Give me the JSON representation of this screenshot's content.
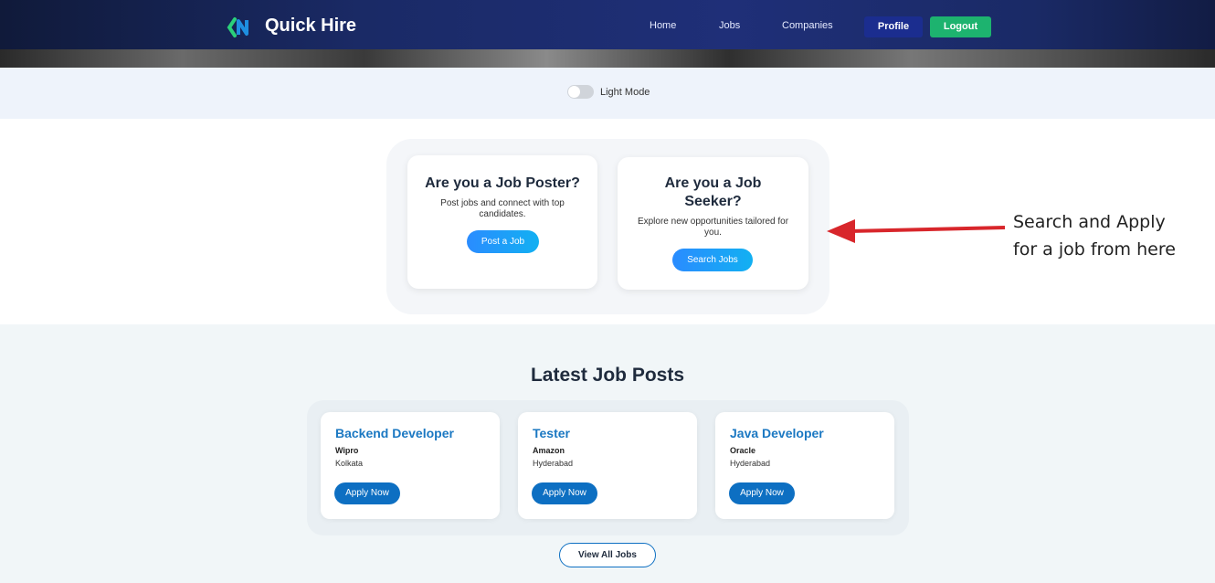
{
  "header": {
    "brand": "Quick Hire",
    "logo_icon": "quick-hire-logo",
    "nav": [
      {
        "label": "Home"
      },
      {
        "label": "Jobs"
      },
      {
        "label": "Companies"
      }
    ],
    "profile_label": "Profile",
    "logout_label": "Logout"
  },
  "theme_toggle": {
    "label": "Light Mode",
    "state": "off"
  },
  "roles": [
    {
      "title": "Are you a Job Poster?",
      "description": "Post jobs and connect with top candidates.",
      "button_label": "Post a Job"
    },
    {
      "title": "Are you a Job Seeker?",
      "description": "Explore new opportunities tailored for you.",
      "button_label": "Search Jobs"
    }
  ],
  "annotation": {
    "text_line1": "Search and Apply",
    "text_line2": "for a job from here",
    "arrow_color": "#d8262b"
  },
  "latest_jobs": {
    "heading": "Latest Job Posts",
    "jobs": [
      {
        "title": "Backend Developer",
        "company": "Wipro",
        "location": "Kolkata",
        "button_label": "Apply Now"
      },
      {
        "title": "Tester",
        "company": "Amazon",
        "location": "Hyderabad",
        "button_label": "Apply Now"
      },
      {
        "title": "Java Developer",
        "company": "Oracle",
        "location": "Hyderabad",
        "button_label": "Apply Now"
      }
    ],
    "view_all_label": "View All Jobs"
  },
  "colors": {
    "header": "#1f2f78",
    "logout": "#1db36f",
    "profile": "#1b2d8f",
    "primary_button": "#0d6fc2",
    "job_title": "#1b78c2"
  }
}
